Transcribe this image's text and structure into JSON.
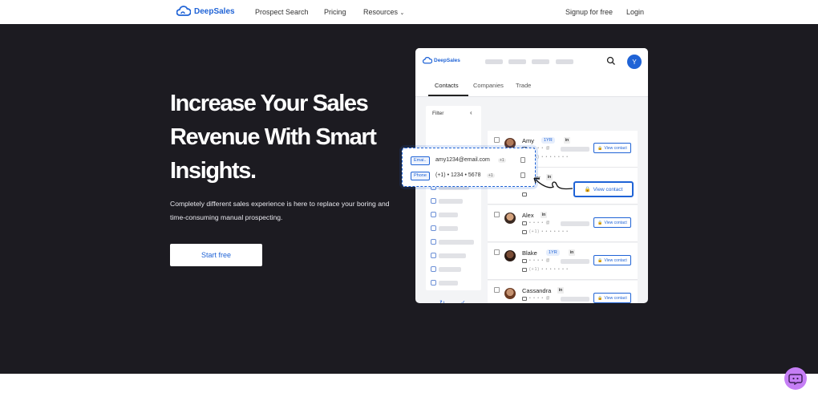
{
  "nav": {
    "logo_text": "DeepSales",
    "links": [
      "Prospect Search",
      "Pricing",
      "Resources"
    ],
    "signup": "Signup for free",
    "login": "Login"
  },
  "hero": {
    "headline_lines": [
      "Increase Your Sales",
      "Revenue With Smart",
      "Insights."
    ],
    "subtext_lines": [
      "Completely different sales experience is here to replace your boring and",
      "time-consuming manual prospecting."
    ],
    "cta": "Start free"
  },
  "mockup": {
    "logo_text": "DeepSales",
    "avatar_letter": "Y",
    "tabs": [
      "Contacts",
      "Companies",
      "Trade"
    ],
    "filter_title": "Filter",
    "popup": {
      "email_tag": "Emai..",
      "email_value": "amy1234@email.com",
      "email_badge": "+1",
      "phone_tag": "Phone",
      "phone_value": "(+1) • 1234 • 5678",
      "phone_badge": "+1"
    },
    "contacts": [
      {
        "name": "Amy",
        "badge": "1YR",
        "linkedin": "in",
        "action": "View contact"
      },
      {
        "name": "w",
        "badge": "",
        "linkedin": "in",
        "action": "View contact"
      },
      {
        "name": "Alex",
        "badge": "",
        "linkedin": "in",
        "action": "View contact"
      },
      {
        "name": "Blake",
        "badge": "1YR",
        "linkedin": "in",
        "action": "View contact"
      },
      {
        "name": "Cassandra",
        "badge": "",
        "linkedin": "in",
        "action": "View contact"
      }
    ],
    "masked_email": "• • • • @",
    "masked_phone": "(+1) • • • • • • •"
  },
  "colors": {
    "accent": "#1f63d6",
    "hero_bg": "#1c1b21",
    "chat": "#c57ef5"
  },
  "icons": [
    "cloud-logo-icon",
    "chevron-down-icon",
    "search-icon",
    "lock-icon",
    "chat-bot-icon",
    "refresh-icon",
    "check-circle-icon",
    "copy-icon"
  ]
}
